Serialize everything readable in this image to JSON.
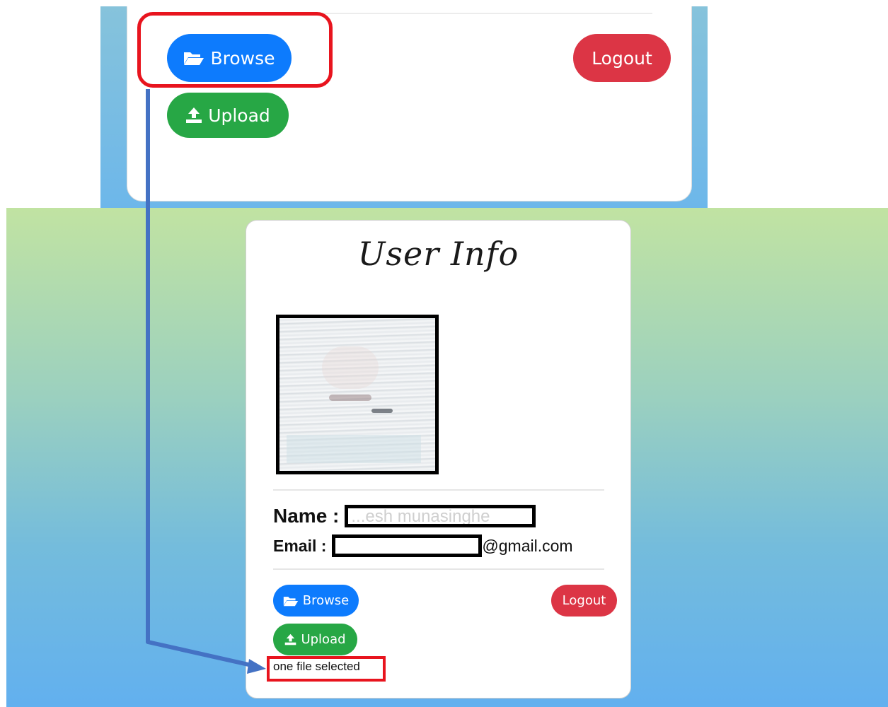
{
  "top_zoom": {
    "browse_label": "Browse",
    "upload_label": "Upload",
    "logout_label": "Logout"
  },
  "card": {
    "title": "User Info",
    "name_label": "Name :",
    "name_value": "...esh munasinghe",
    "email_label": "Email :",
    "email_suffix": "@gmail.com",
    "browse_label": "Browse",
    "upload_label": "Upload",
    "logout_label": "Logout",
    "status": "one file selected"
  },
  "icons": {
    "browse": "folder-open-icon",
    "upload": "upload-icon"
  },
  "colors": {
    "browse": "#0d7bfd",
    "upload": "#27a745",
    "logout": "#dc3545",
    "highlight": "#e8141e",
    "connector": "#4472c4"
  }
}
